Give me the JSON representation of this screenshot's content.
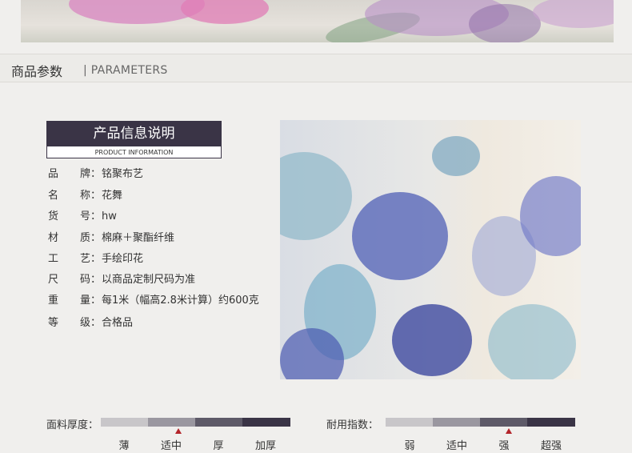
{
  "section": {
    "title": "商品参数",
    "subtitle": "| PARAMETERS"
  },
  "info_box": {
    "title": "产品信息说明",
    "subtitle": "PRODUCT INFORMATION"
  },
  "specs": [
    {
      "label": [
        "品",
        "牌："
      ],
      "value": "铭聚布艺"
    },
    {
      "label": [
        "名",
        "称："
      ],
      "value": "花舞"
    },
    {
      "label": [
        "货",
        "号："
      ],
      "value": "hw"
    },
    {
      "label": [
        "材",
        "质："
      ],
      "value": "棉麻＋聚酯纤维"
    },
    {
      "label": [
        "工",
        "艺："
      ],
      "value": "手绘印花"
    },
    {
      "label": [
        "尺",
        "码："
      ],
      "value": "以商品定制尺码为准"
    },
    {
      "label": [
        "重",
        "量："
      ],
      "value": "每1米（幅高2.8米计算）约600克"
    },
    {
      "label": [
        "等",
        "级："
      ],
      "value": "合格品"
    }
  ],
  "thickness": {
    "label": "面料厚度：",
    "levels": [
      "薄",
      "适中",
      "厚",
      "加厚"
    ],
    "selected": "适中",
    "colors": [
      "#c8c6c9",
      "#9a97a0",
      "#5e5a68",
      "#3a3446"
    ]
  },
  "durability": {
    "label": "耐用指数：",
    "levels": [
      "弱",
      "适中",
      "强",
      "超强"
    ],
    "selected": "强",
    "colors": [
      "#c8c6c9",
      "#9a97a0",
      "#5e5a68",
      "#3a3446"
    ]
  },
  "marker_color": "#b3242a"
}
